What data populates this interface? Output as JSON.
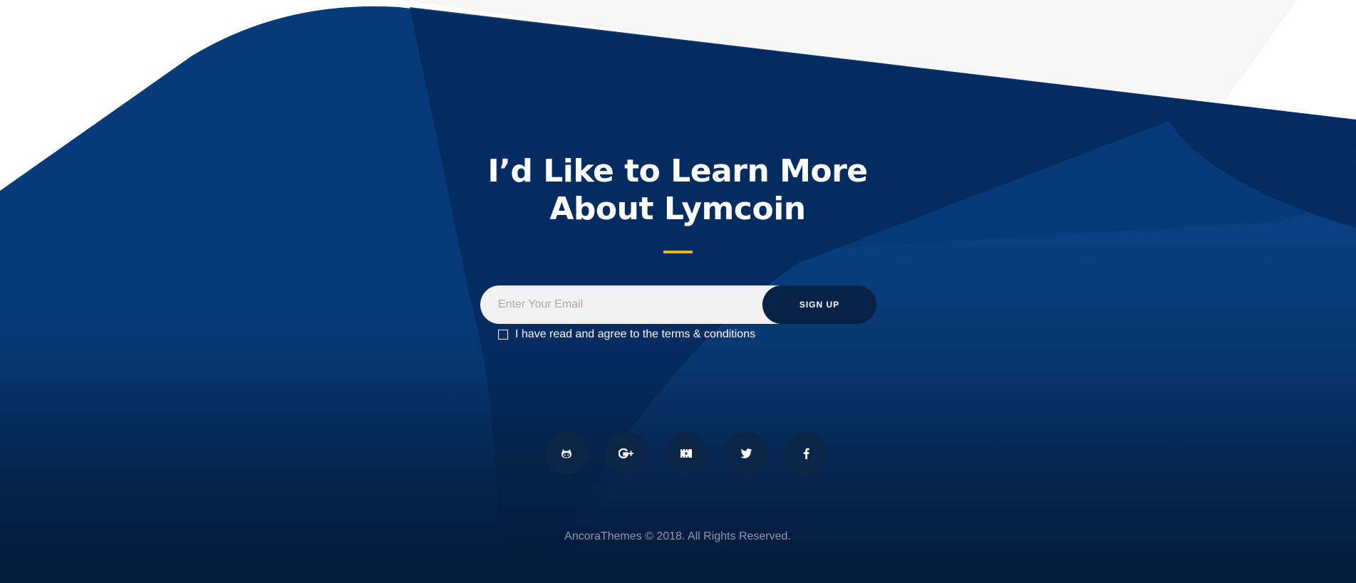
{
  "headline": {
    "line1": "I’d Like to Learn More",
    "line2": "About Lymcoin"
  },
  "signup_form": {
    "email_placeholder": "Enter Your Email",
    "email_value": "",
    "submit_label": "SIGN UP",
    "terms_label": "I have read and agree to the terms & conditions",
    "terms_checked": false
  },
  "social_links": [
    {
      "icon": "github-icon"
    },
    {
      "icon": "google-plus-icon"
    },
    {
      "icon": "video-icon"
    },
    {
      "icon": "twitter-icon"
    },
    {
      "icon": "facebook-icon"
    }
  ],
  "footer": {
    "copyright": "AncoraThemes © 2018. All Rights Reserved."
  },
  "colors": {
    "background_dark": "#06234a",
    "background_mid": "#063a7a",
    "accent": "#f3b21b",
    "button_dark": "#062246",
    "social_circle": "#0b2547",
    "copyright_text": "#8d9bb0"
  }
}
